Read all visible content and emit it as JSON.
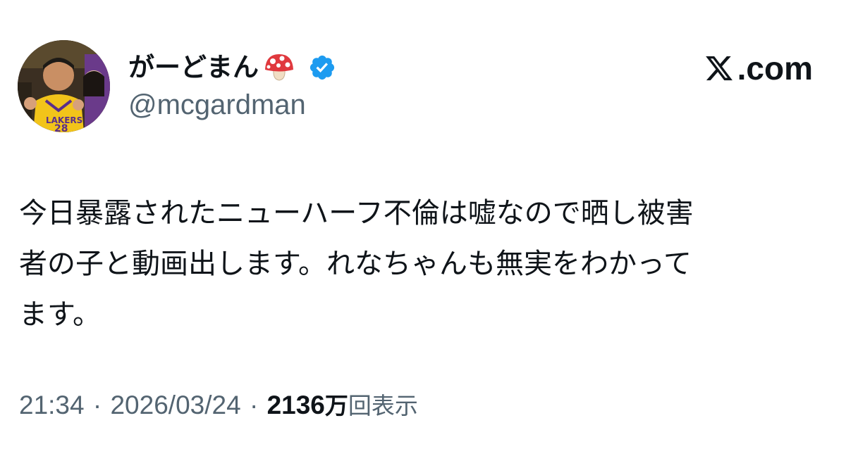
{
  "author": {
    "display_name": "がーどまん",
    "name_emoji": "mushroom-icon",
    "verified": true,
    "handle": "@mcgardman"
  },
  "site": {
    "logo": "x-logo-icon",
    "label": ".com"
  },
  "tweet": {
    "lines": [
      "今日暴露されたニューハーフ不倫は嘘なので晒し被害",
      "者の子と動画出します。れなちゃんも無実をわかって",
      "ます。"
    ]
  },
  "meta": {
    "time": "21:34",
    "separator": "·",
    "date": "2026/03/24",
    "views_count": "2136",
    "views_unit": "万",
    "views_label": "回表示"
  },
  "colors": {
    "text": "#0f1419",
    "secondary": "#536471",
    "verified": "#1d9bf0",
    "mushroom_cap": "#e0393e"
  }
}
